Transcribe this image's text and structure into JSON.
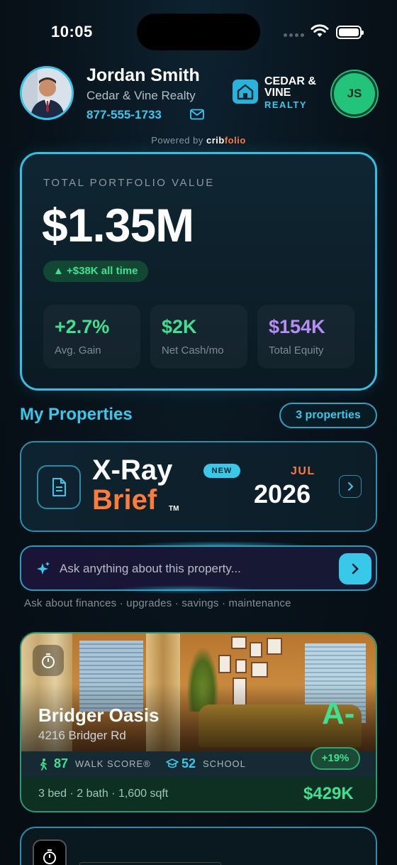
{
  "status_bar": {
    "time": "10:05"
  },
  "agent": {
    "name": "Jordan Smith",
    "company": "Cedar & Vine Realty",
    "phone": "877-555-1733"
  },
  "brand": {
    "name": "CEDAR & VINE",
    "sub": "REALTY"
  },
  "user": {
    "initials": "JS"
  },
  "powered_by": {
    "prefix": "Powered by",
    "brand_a": "crib",
    "brand_b": "folio"
  },
  "portfolio": {
    "label": "TOTAL PORTFOLIO VALUE",
    "value": "$1.35M",
    "change": "▲ +$38K all time",
    "stats": [
      {
        "value": "+2.7%",
        "label": "Avg. Gain",
        "color": "#3fe08f"
      },
      {
        "value": "$2K",
        "label": "Net Cash/mo",
        "color": "#3fe08f"
      },
      {
        "value": "$154K",
        "label": "Total Equity",
        "color": "#b88cf5"
      }
    ]
  },
  "properties_section": {
    "title": "My Properties",
    "count": "3 properties"
  },
  "xray": {
    "title": "X-Ray",
    "subtitle": "Brief",
    "tm": "TM",
    "badge": "NEW",
    "month": "JUL",
    "year": "2026"
  },
  "ask": {
    "placeholder": "Ask anything about this property...",
    "hint": "Ask about finances · upgrades · savings · maintenance"
  },
  "property": {
    "name": "Bridger Oasis",
    "address": "4216 Bridger Rd",
    "grade": "A-",
    "growth": "+19%",
    "walk_score": "87",
    "walk_label": "WALK SCORE®",
    "school_score": "52",
    "school_label": "SCHOOL",
    "specs": "3 bed · 2 bath · 1,600 sqft",
    "price": "$429K"
  },
  "colors": {
    "accent": "#37c8ea",
    "positive": "#3fe08f",
    "brand_orange": "#ff7b3a",
    "purple": "#b88cf5"
  }
}
